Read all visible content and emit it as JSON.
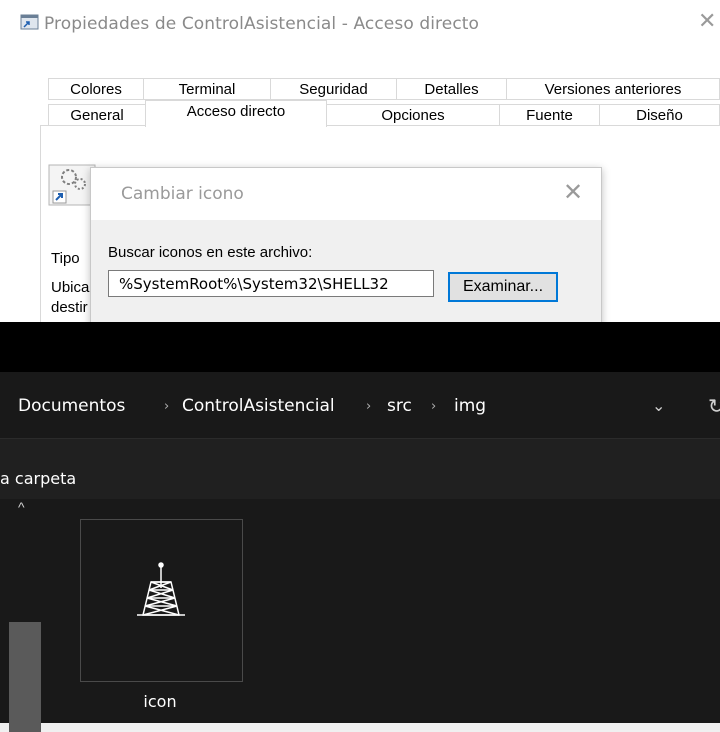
{
  "properties_dialog": {
    "title": "Propiedades de ControlAsistencial - Acceso directo",
    "close_glyph": "✕",
    "tabs_row1": [
      "Colores",
      "Terminal",
      "Seguridad",
      "Detalles",
      "Versiones anteriores"
    ],
    "tabs_row2": [
      "General",
      "Acceso directo",
      "Opciones",
      "Fuente",
      "Diseño"
    ],
    "active_tab": "Acceso directo",
    "partial_labels": [
      "Tipo",
      "Ubica",
      "destir"
    ]
  },
  "change_icon_dialog": {
    "title": "Cambiar icono",
    "close_glyph": "✕",
    "search_label": "Buscar iconos en este archivo:",
    "file_path_value": "%SystemRoot%\\System32\\SHELL32",
    "browse_button": "Examinar..."
  },
  "explorer": {
    "breadcrumb": [
      "Documentos",
      "ControlAsistencial",
      "src",
      "img"
    ],
    "breadcrumb_separator": "›",
    "dropdown_glyph": "⌄",
    "refresh_glyph": "↻",
    "new_folder_label": "a carpeta",
    "scroll_up_glyph": "^",
    "files": [
      {
        "name": "icon",
        "icon": "antenna-tower-icon"
      }
    ]
  },
  "colors": {
    "accent": "#0078d7",
    "explorer_bg": "#191919"
  }
}
